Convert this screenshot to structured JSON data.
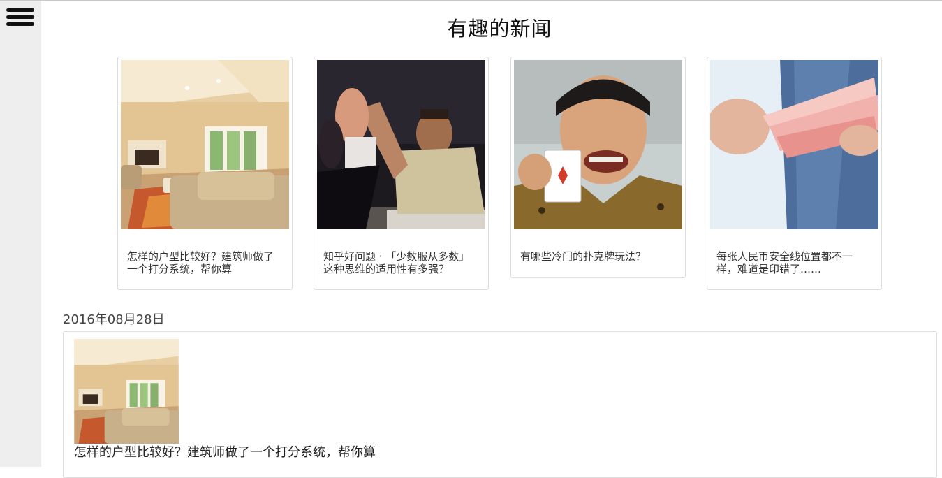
{
  "app": {
    "title": "有趣的新闻"
  },
  "sidebar": {
    "menu_icon": "hamburger-menu-icon"
  },
  "cards": [
    {
      "caption": "怎样的户型比较好？建筑师做了一个打分系统，帮你算",
      "image": "living-room-photo"
    },
    {
      "caption": "知乎好问题 · 「少数服从多数」这种思维的适用性有多强？",
      "image": "raised-hands-meeting-photo"
    },
    {
      "caption": "有哪些冷门的扑克牌玩法？",
      "image": "smiling-man-holding-card-photo"
    },
    {
      "caption": "每张人民币安全线位置都不一样，难道是印错了……",
      "image": "hands-counting-banknotes-photo"
    }
  ],
  "feed": {
    "date": "2016年08月28日",
    "items": [
      {
        "title": "怎样的户型比较好？建筑师做了一个打分系统，帮你算",
        "image": "living-room-photo"
      }
    ]
  },
  "colors": {
    "sidebar_bg": "#eeeeee",
    "border": "#dddddd",
    "title_text": "#111111"
  }
}
